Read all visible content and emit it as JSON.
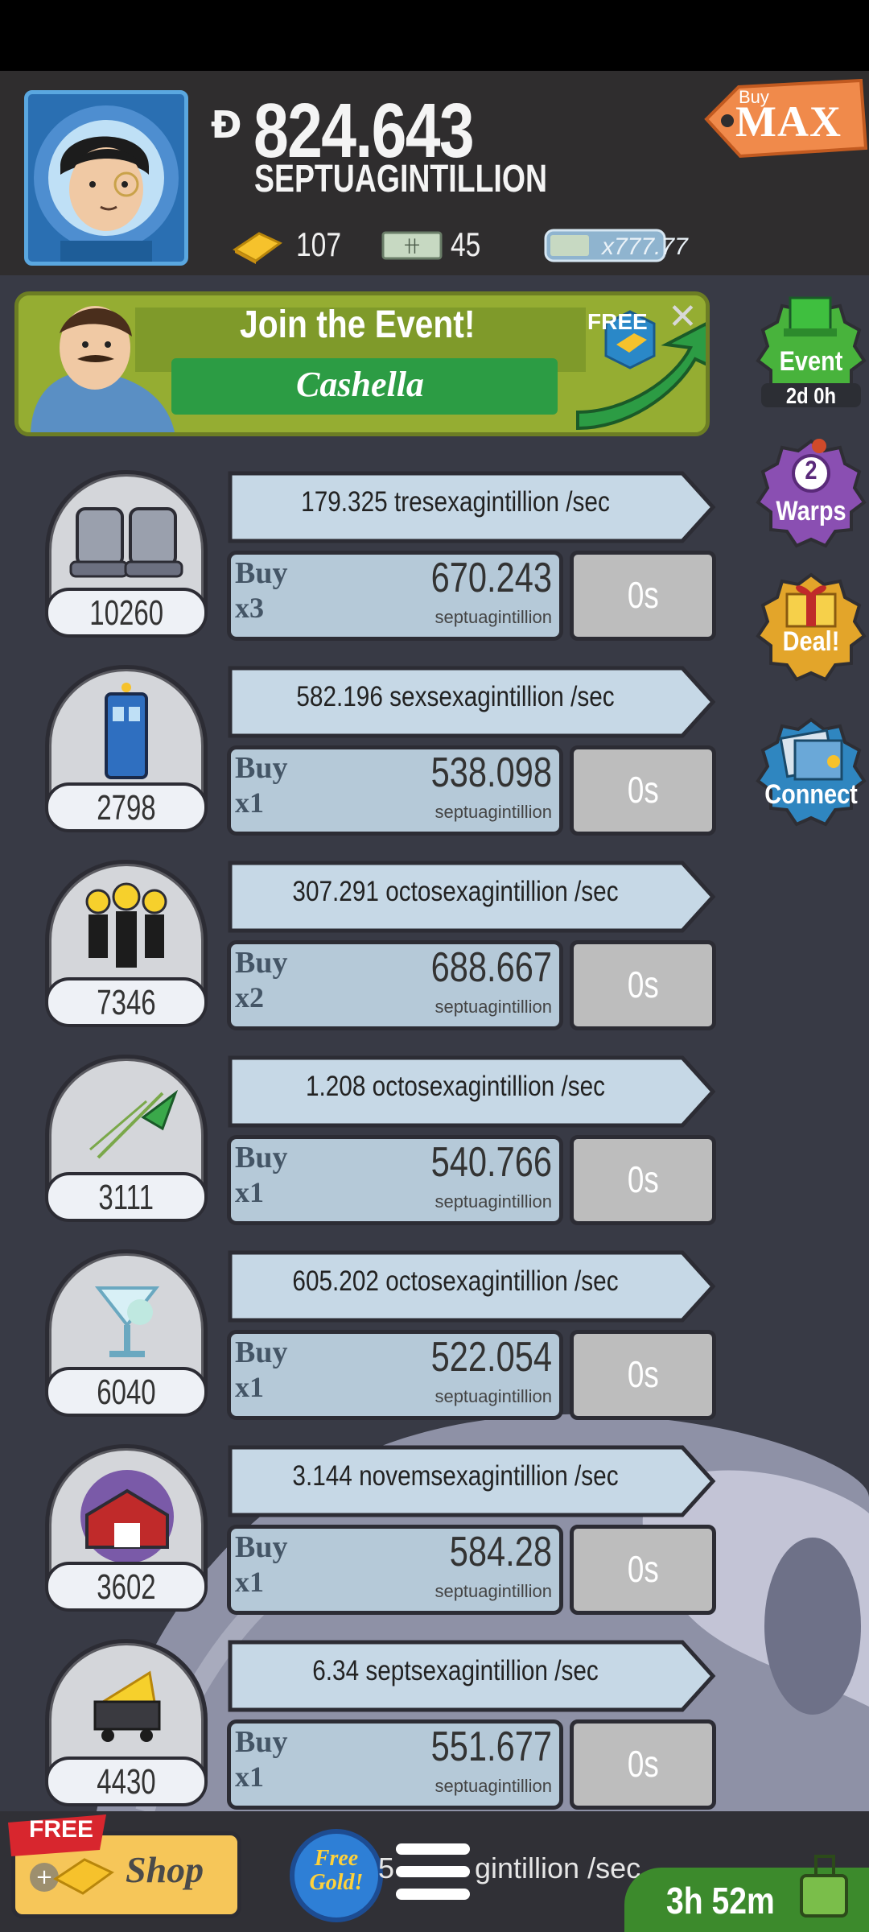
{
  "header": {
    "cash_value": "824.643",
    "cash_unit": "SEPTUAGINTILLION",
    "gold_count": "107",
    "megabucks_count": "45",
    "multiplier": "x777.77",
    "buy_max_top": "Buy",
    "buy_max_main": "MAX"
  },
  "event": {
    "title": "Join the Event!",
    "name": "Cashella",
    "free_badge": "FREE",
    "close_symbol": "✕"
  },
  "side_buttons": {
    "event_label": "Event",
    "event_timer": "2d 0h",
    "warps_count": "2",
    "warps_label": "Warps",
    "deal_label": "Deal!",
    "connect_label": "Connect"
  },
  "businesses": [
    {
      "icon": "moon-boots-icon",
      "count": "10260",
      "rate": "179.325 tresexagintillion /sec",
      "buy_label": "Buy",
      "buy_mult": "x3",
      "cost": "670.243",
      "cost_unit": "septuagintillion",
      "timer": "0s"
    },
    {
      "icon": "phone-booth-icon",
      "count": "2798",
      "rate": "582.196 sexsexagintillion /sec",
      "buy_label": "Buy",
      "buy_mult": "x1",
      "cost": "538.098",
      "cost_unit": "septuagintillion",
      "timer": "0s"
    },
    {
      "icon": "clones-icon",
      "count": "7346",
      "rate": "307.291 octosexagintillion /sec",
      "buy_label": "Buy",
      "buy_mult": "x2",
      "cost": "688.667",
      "cost_unit": "septuagintillion",
      "timer": "0s"
    },
    {
      "icon": "rocket-icon",
      "count": "3111",
      "rate": "1.208 octosexagintillion /sec",
      "buy_label": "Buy",
      "buy_mult": "x1",
      "cost": "540.766",
      "cost_unit": "septuagintillion",
      "timer": "0s"
    },
    {
      "icon": "cocktail-glass-icon",
      "count": "6040",
      "rate": "605.202 octosexagintillion /sec",
      "buy_label": "Buy",
      "buy_mult": "x1",
      "cost": "522.054",
      "cost_unit": "septuagintillion",
      "timer": "0s"
    },
    {
      "icon": "barn-icon",
      "count": "3602",
      "rate": "3.144 novemsexagintillion /sec",
      "buy_label": "Buy",
      "buy_mult": "x1",
      "cost": "584.28",
      "cost_unit": "septuagintillion",
      "timer": "0s"
    },
    {
      "icon": "cheese-mine-cart-icon",
      "count": "4430",
      "rate": "6.34 septsexagintillion /sec",
      "buy_label": "Buy",
      "buy_mult": "x1",
      "cost": "551.677",
      "cost_unit": "septuagintillion",
      "timer": "0s"
    }
  ],
  "bottom": {
    "free_ribbon": "FREE",
    "shop_label": "Shop",
    "free_gold_label": "Free Gold!",
    "partial_rate_digit": "5",
    "partial_rate": "gintillion /sec",
    "timer": "3h 52m"
  },
  "colors": {
    "background": "#383a45",
    "header": "#2f2d2e",
    "rate_bar": "#c6d8e6",
    "buy_button": "#b5c9d8",
    "timer_button": "#bdbdbd",
    "event_green": "#2c9c44",
    "buy_max_orange": "#f08a4b"
  }
}
